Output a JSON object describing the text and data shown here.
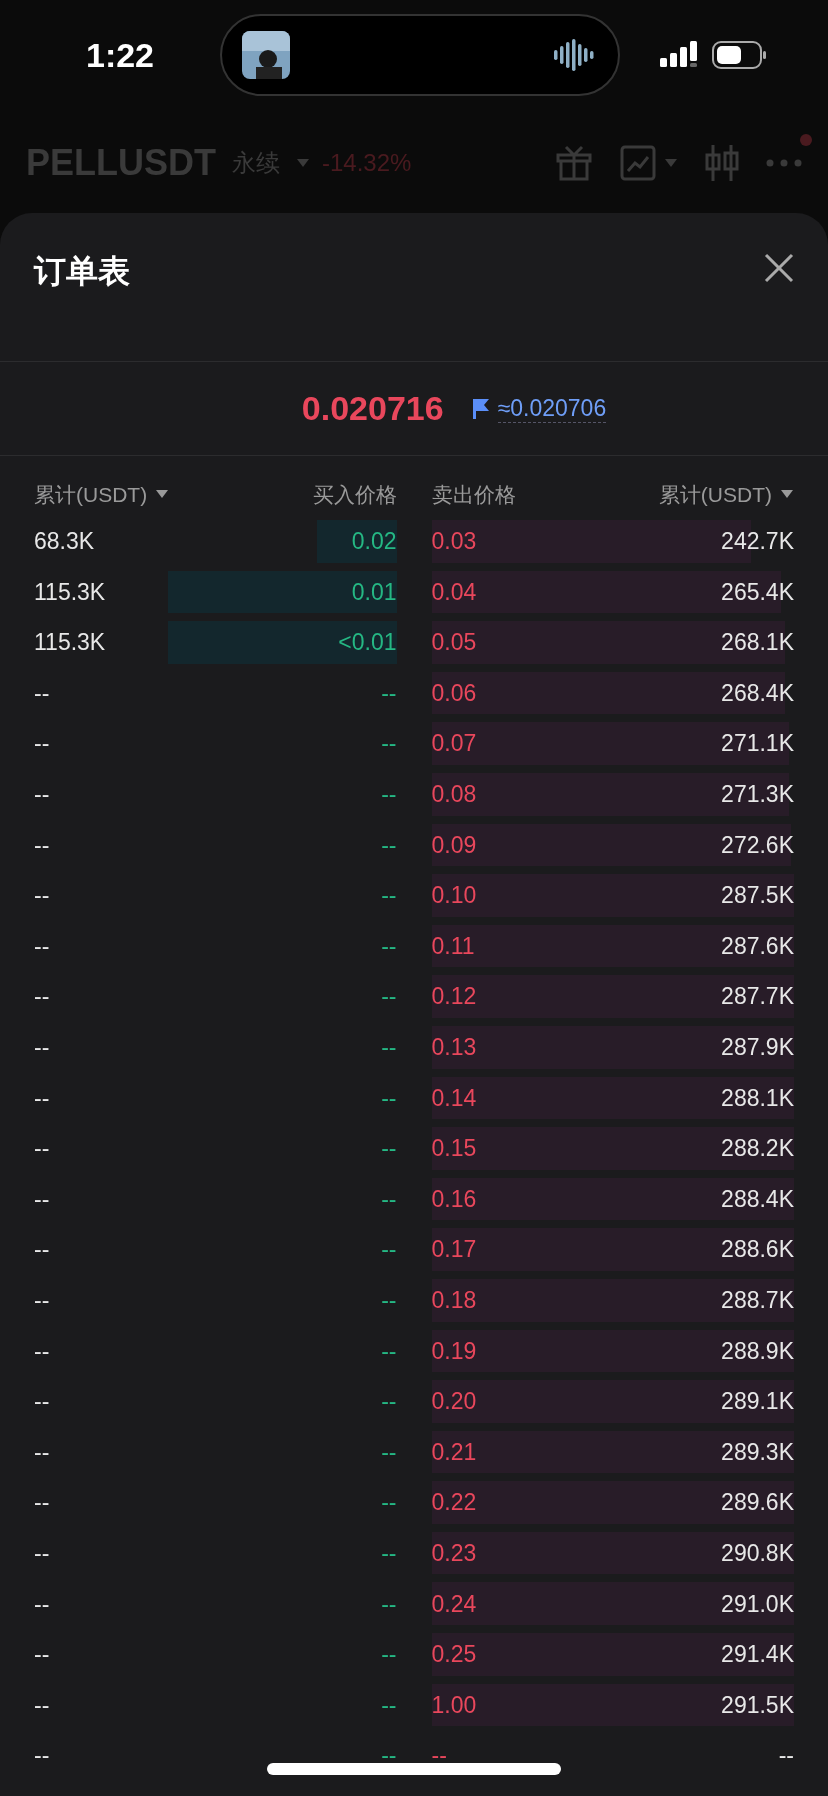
{
  "status_bar": {
    "time": "1:22"
  },
  "background_header": {
    "symbol": "PELLUSDT",
    "contract_type": "永续",
    "change": "-14.32%"
  },
  "sheet": {
    "title": "订单表",
    "last_price": "0.020716",
    "mark_price": "≈0.020706",
    "columns": [
      "累计(USDT)",
      "买入价格",
      "卖出价格",
      "累计(USDT)"
    ],
    "bids": [
      {
        "total": "68.3K",
        "price": "0.02"
      },
      {
        "total": "115.3K",
        "price": "0.01"
      },
      {
        "total": "115.3K",
        "price": "<0.01"
      },
      {
        "total": "--",
        "price": "--"
      },
      {
        "total": "--",
        "price": "--"
      },
      {
        "total": "--",
        "price": "--"
      },
      {
        "total": "--",
        "price": "--"
      },
      {
        "total": "--",
        "price": "--"
      },
      {
        "total": "--",
        "price": "--"
      },
      {
        "total": "--",
        "price": "--"
      },
      {
        "total": "--",
        "price": "--"
      },
      {
        "total": "--",
        "price": "--"
      },
      {
        "total": "--",
        "price": "--"
      },
      {
        "total": "--",
        "price": "--"
      },
      {
        "total": "--",
        "price": "--"
      },
      {
        "total": "--",
        "price": "--"
      },
      {
        "total": "--",
        "price": "--"
      },
      {
        "total": "--",
        "price": "--"
      },
      {
        "total": "--",
        "price": "--"
      },
      {
        "total": "--",
        "price": "--"
      },
      {
        "total": "--",
        "price": "--"
      },
      {
        "total": "--",
        "price": "--"
      },
      {
        "total": "--",
        "price": "--"
      },
      {
        "total": "--",
        "price": "--"
      },
      {
        "total": "--",
        "price": "--"
      }
    ],
    "asks": [
      {
        "price": "0.03",
        "total": "242.7K"
      },
      {
        "price": "0.04",
        "total": "265.4K"
      },
      {
        "price": "0.05",
        "total": "268.1K"
      },
      {
        "price": "0.06",
        "total": "268.4K"
      },
      {
        "price": "0.07",
        "total": "271.1K"
      },
      {
        "price": "0.08",
        "total": "271.3K"
      },
      {
        "price": "0.09",
        "total": "272.6K"
      },
      {
        "price": "0.10",
        "total": "287.5K"
      },
      {
        "price": "0.11",
        "total": "287.6K"
      },
      {
        "price": "0.12",
        "total": "287.7K"
      },
      {
        "price": "0.13",
        "total": "287.9K"
      },
      {
        "price": "0.14",
        "total": "288.1K"
      },
      {
        "price": "0.15",
        "total": "288.2K"
      },
      {
        "price": "0.16",
        "total": "288.4K"
      },
      {
        "price": "0.17",
        "total": "288.6K"
      },
      {
        "price": "0.18",
        "total": "288.7K"
      },
      {
        "price": "0.19",
        "total": "288.9K"
      },
      {
        "price": "0.20",
        "total": "289.1K"
      },
      {
        "price": "0.21",
        "total": "289.3K"
      },
      {
        "price": "0.22",
        "total": "289.6K"
      },
      {
        "price": "0.23",
        "total": "290.8K"
      },
      {
        "price": "0.24",
        "total": "291.0K"
      },
      {
        "price": "0.25",
        "total": "291.4K"
      },
      {
        "price": "1.00",
        "total": "291.5K"
      },
      {
        "price": "--",
        "total": "--"
      }
    ]
  }
}
